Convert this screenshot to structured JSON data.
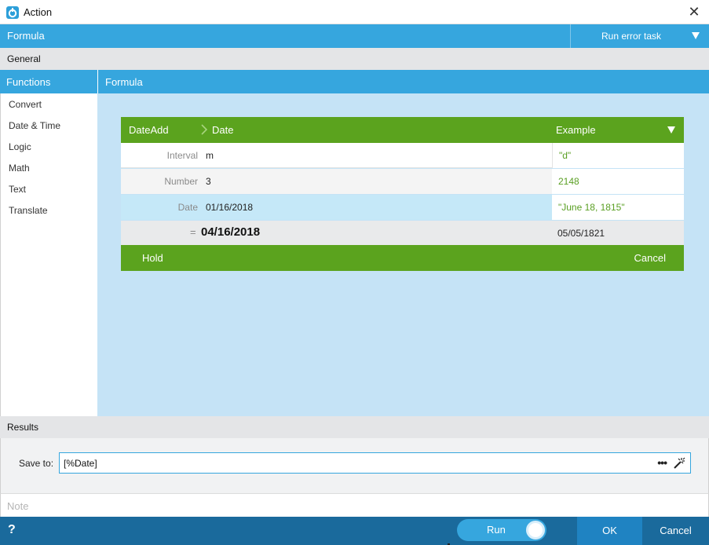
{
  "window": {
    "title": "Action",
    "close_glyph": "✕"
  },
  "formula_bar": {
    "label": "Formula",
    "run_error_task": "Run error task"
  },
  "general": {
    "label": "General"
  },
  "functions": {
    "header": "Functions",
    "items": [
      {
        "label": "Convert"
      },
      {
        "label": "Date & Time"
      },
      {
        "label": "Logic"
      },
      {
        "label": "Math"
      },
      {
        "label": "Text"
      },
      {
        "label": "Translate"
      }
    ]
  },
  "formula_panel": {
    "header": "Formula",
    "function_name": "DateAdd",
    "signature": "Date",
    "example_header": "Example",
    "params": [
      {
        "name": "Interval",
        "value": "m",
        "example": "\"d\""
      },
      {
        "name": "Number",
        "value": "3",
        "example": "2148"
      },
      {
        "name": "Date",
        "value": "01/16/2018",
        "example": "\"June 18, 1815\""
      }
    ],
    "result": {
      "equals": "=",
      "value": "04/16/2018",
      "example": "05/05/1821"
    },
    "hold_label": "Hold",
    "cancel_label": "Cancel"
  },
  "results": {
    "label": "Results",
    "save_to_label": "Save to:",
    "save_to_value": "[%Date]",
    "more_glyph": "•••"
  },
  "note": {
    "placeholder": "Note",
    "value": ""
  },
  "footer": {
    "help_glyph": "?",
    "run_label": "Run",
    "ok_label": "OK",
    "cancel_label": "Cancel"
  },
  "colors": {
    "accent_blue": "#36a6de",
    "dark_blue": "#1a6a9c",
    "green": "#5ba31e",
    "example_green": "#5a9f23",
    "panel_bg": "#c5e3f6"
  }
}
